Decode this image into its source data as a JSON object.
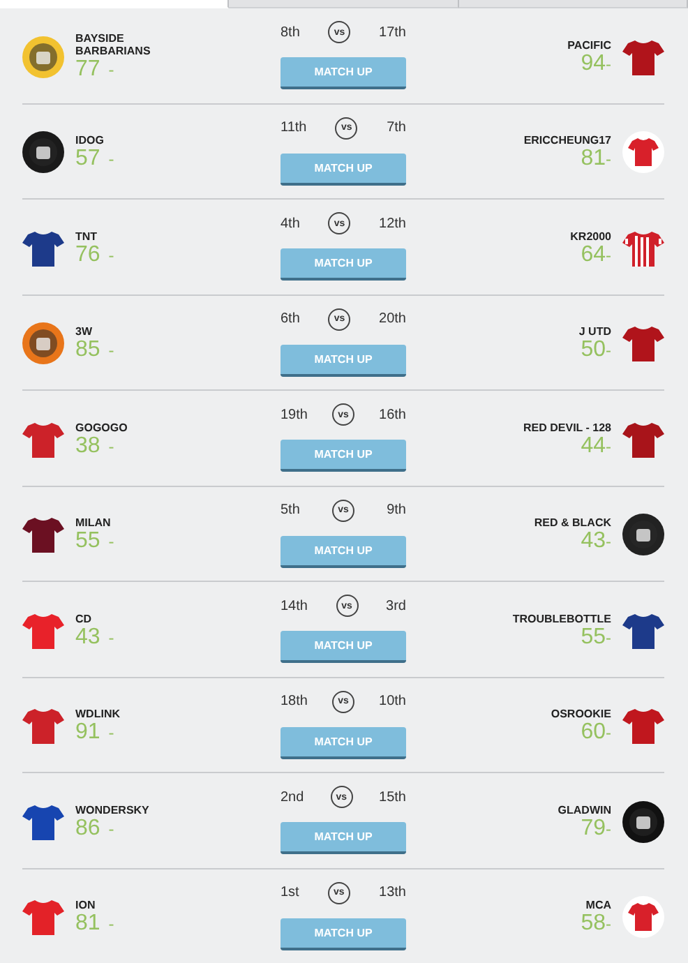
{
  "tabs": [
    {
      "selected": true
    },
    {
      "selected": false
    },
    {
      "selected": false
    }
  ],
  "matches": [
    {
      "home": {
        "name": "BAYSIDE BARBARIANS",
        "score": "77",
        "trend": "-",
        "rank": "8th",
        "badge": {
          "kind": "crest",
          "color": "#f2c230"
        }
      },
      "vs": "vs",
      "button": "MATCH UP",
      "away": {
        "name": "PACIFIC",
        "score": "94",
        "trend": "-",
        "rank": "17th",
        "badge": {
          "kind": "shirt",
          "color": "#b0141b"
        }
      }
    },
    {
      "home": {
        "name": "IDOG",
        "score": "57",
        "trend": "-",
        "rank": "11th",
        "badge": {
          "kind": "crest",
          "color": "#1a1a1a"
        }
      },
      "vs": "vs",
      "button": "MATCH UP",
      "away": {
        "name": "ERICCHEUNG17",
        "score": "81",
        "trend": "-",
        "rank": "7th",
        "badge": {
          "kind": "round-shirt",
          "color": "#d8202a"
        }
      }
    },
    {
      "home": {
        "name": "TNT",
        "score": "76",
        "trend": "-",
        "rank": "4th",
        "badge": {
          "kind": "shirt",
          "color": "#1d3a8a"
        }
      },
      "vs": "vs",
      "button": "MATCH UP",
      "away": {
        "name": "KR2000",
        "score": "64",
        "trend": "-",
        "rank": "12th",
        "badge": {
          "kind": "striped-shirt",
          "color": "#d0202a"
        }
      }
    },
    {
      "home": {
        "name": "3W",
        "score": "85",
        "trend": "-",
        "rank": "6th",
        "badge": {
          "kind": "crest",
          "color": "#e8751a"
        }
      },
      "vs": "vs",
      "button": "MATCH UP",
      "away": {
        "name": "J UTD",
        "score": "50",
        "trend": "-",
        "rank": "20th",
        "badge": {
          "kind": "shirt",
          "color": "#b0141b"
        }
      }
    },
    {
      "home": {
        "name": "GOGOGO",
        "score": "38",
        "trend": "-",
        "rank": "19th",
        "badge": {
          "kind": "shirt",
          "color": "#cc2229"
        }
      },
      "vs": "vs",
      "button": "MATCH UP",
      "away": {
        "name": "RED DEVIL - 128",
        "score": "44",
        "trend": "-",
        "rank": "16th",
        "badge": {
          "kind": "shirt",
          "color": "#a8141a"
        }
      }
    },
    {
      "home": {
        "name": "MILAN",
        "score": "55",
        "trend": "-",
        "rank": "5th",
        "badge": {
          "kind": "shirt",
          "color": "#6b1022"
        }
      },
      "vs": "vs",
      "button": "MATCH UP",
      "away": {
        "name": "RED & BLACK",
        "score": "43",
        "trend": "-",
        "rank": "9th",
        "badge": {
          "kind": "crest",
          "color": "#222222"
        }
      }
    },
    {
      "home": {
        "name": "CD",
        "score": "43",
        "trend": "-",
        "rank": "14th",
        "badge": {
          "kind": "shirt",
          "color": "#e8222a"
        }
      },
      "vs": "vs",
      "button": "MATCH UP",
      "away": {
        "name": "TROUBLEBOTTLE",
        "score": "55",
        "trend": "-",
        "rank": "3rd",
        "badge": {
          "kind": "shirt",
          "color": "#1d3a8a"
        }
      }
    },
    {
      "home": {
        "name": "WDLINK",
        "score": "91",
        "trend": "-",
        "rank": "18th",
        "badge": {
          "kind": "shirt",
          "color": "#cc2229"
        }
      },
      "vs": "vs",
      "button": "MATCH UP",
      "away": {
        "name": "OSROOKIE",
        "score": "60",
        "trend": "-",
        "rank": "10th",
        "badge": {
          "kind": "shirt",
          "color": "#c0171e"
        }
      }
    },
    {
      "home": {
        "name": "WONDERSKY",
        "score": "86",
        "trend": "-",
        "rank": "2nd",
        "badge": {
          "kind": "shirt",
          "color": "#1745b0"
        }
      },
      "vs": "vs",
      "button": "MATCH UP",
      "away": {
        "name": "GLADWIN",
        "score": "79",
        "trend": "-",
        "rank": "15th",
        "badge": {
          "kind": "crest",
          "color": "#111111"
        }
      }
    },
    {
      "home": {
        "name": "ION",
        "score": "81",
        "trend": "-",
        "rank": "1st",
        "badge": {
          "kind": "shirt",
          "color": "#e32228"
        }
      },
      "vs": "vs",
      "button": "MATCH UP",
      "away": {
        "name": "MCA",
        "score": "58",
        "trend": "-",
        "rank": "13th",
        "badge": {
          "kind": "round-shirt",
          "color": "#d8202a"
        }
      }
    }
  ]
}
